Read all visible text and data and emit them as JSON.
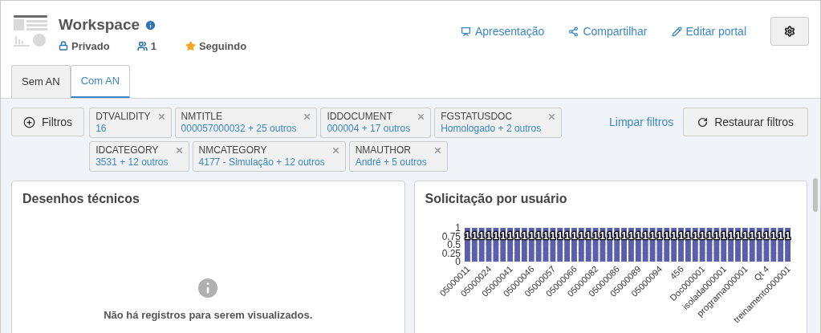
{
  "header": {
    "title": "Workspace",
    "privacy": "Privado",
    "members": "1",
    "following": "Seguindo",
    "actions": [
      {
        "kind": "presentation",
        "label": "Apresentação"
      },
      {
        "kind": "share",
        "label": "Compartilhar"
      },
      {
        "kind": "edit",
        "label": "Editar portal"
      }
    ]
  },
  "tabs": [
    {
      "label": "Sem AN",
      "selected": false
    },
    {
      "label": "Com AN",
      "selected": true
    }
  ],
  "filters_button": "Filtros",
  "filters": [
    {
      "field": "DTVALIDITY",
      "value": "16"
    },
    {
      "field": "NMTITLE",
      "value": "000057000032 + 25 outros"
    },
    {
      "field": "IDDOCUMENT",
      "value": "000004 + 17 outros"
    },
    {
      "field": "FGSTATUSDOC",
      "value": "Homologado + 2 outros"
    },
    {
      "field": "IDCATEGORY",
      "value": "3531 + 12 outros"
    },
    {
      "field": "NMCATEGORY",
      "value": "4177 - Simulação + 12 outros"
    },
    {
      "field": "NMAUTHOR",
      "value": "André + 5 outros"
    }
  ],
  "clear_filters": "Limpar filtros",
  "restore_filters": "Restaurar filtros",
  "cards": [
    {
      "title": "Desenhos técnicos",
      "empty_message": "Não há registros para serem visualizados."
    },
    {
      "title": "Solicitação por usuário",
      "chart_data": {
        "type": "bar",
        "categories": [
          "05000011",
          null,
          null,
          "05000024",
          null,
          null,
          "05000041",
          null,
          null,
          "05000046",
          null,
          null,
          "05000057",
          null,
          null,
          "05000066",
          null,
          null,
          "05000082",
          null,
          null,
          "05000086",
          null,
          null,
          "05000089",
          null,
          null,
          "05000094",
          null,
          null,
          "456",
          null,
          null,
          "Doc000001",
          null,
          null,
          "isolada000001",
          null,
          null,
          "programa000001",
          null,
          null,
          "Qt 4",
          null,
          null,
          "treinamento000001"
        ],
        "values": [
          1,
          1,
          1,
          1,
          1,
          1,
          1,
          1,
          1,
          1,
          1,
          1,
          1,
          1,
          1,
          1,
          1,
          1,
          1,
          1,
          1,
          1,
          1,
          1,
          1,
          1,
          1,
          1,
          1,
          1,
          1,
          1,
          1,
          1,
          1,
          1,
          1,
          1,
          1,
          1,
          1,
          1,
          1,
          1,
          1,
          1
        ],
        "value_labels": [
          "1",
          "1",
          "1",
          "1",
          "1",
          "1",
          "1",
          "1",
          "1",
          "1",
          "1",
          "1",
          "1",
          "1",
          "1",
          "1",
          "1",
          "1",
          "1",
          "1",
          "1",
          "1",
          "1",
          "1",
          "1",
          "1",
          "1",
          "1",
          "1",
          "1",
          "1",
          "1",
          "1",
          "1",
          "1",
          "1",
          "1",
          "1",
          "1",
          "1",
          "1",
          "1",
          "1",
          "1",
          "1",
          "1"
        ],
        "ylim": [
          0,
          1
        ],
        "yticks": [
          0,
          0.25,
          0.5,
          0.75,
          1
        ],
        "grid": true,
        "data_labels": true
      }
    }
  ]
}
